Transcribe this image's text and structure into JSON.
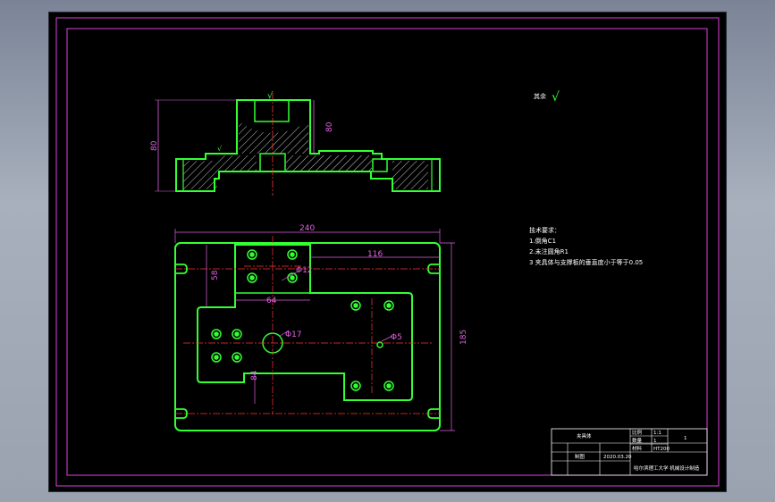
{
  "drawing": {
    "roughness_symbol": "√",
    "roughness_note": "其余",
    "dimensions": {
      "overall_width": "240",
      "right_length": "116",
      "overall_height": "185",
      "left_height": "58",
      "boss_width": "64",
      "hole_small_dia": "Φ12",
      "hole_center_dia": "Φ17",
      "hole_right_dia": "Φ5",
      "lower_offset": "84",
      "section_total_height": "80",
      "section_boss_height": "80",
      "section_symbol": "√"
    },
    "notes": {
      "title": "技术要求：",
      "line1": "1.倒角C1",
      "line2": "2.未注圆角R1",
      "line3": "3 夹具体与支撑板的垂直度小于等于0.05"
    },
    "title_block": {
      "part_name": "夹具体",
      "scale_label": "比例",
      "scale_value": "1:1",
      "qty_label": "数量",
      "qty_value": "1",
      "material_label": "材料",
      "material_value": "HT200",
      "sheet_no": "1",
      "drawn_label": "制图",
      "drawn_date": "2020.03.20",
      "school_line": "哈尔滨理工大学 机械设计制造"
    }
  },
  "colors": {
    "background": "#000000",
    "frame": "#e040e0",
    "outline": "#33ff33",
    "dimension": "#e060e0",
    "text": "#ffffff",
    "centerline": "#ff3333"
  }
}
